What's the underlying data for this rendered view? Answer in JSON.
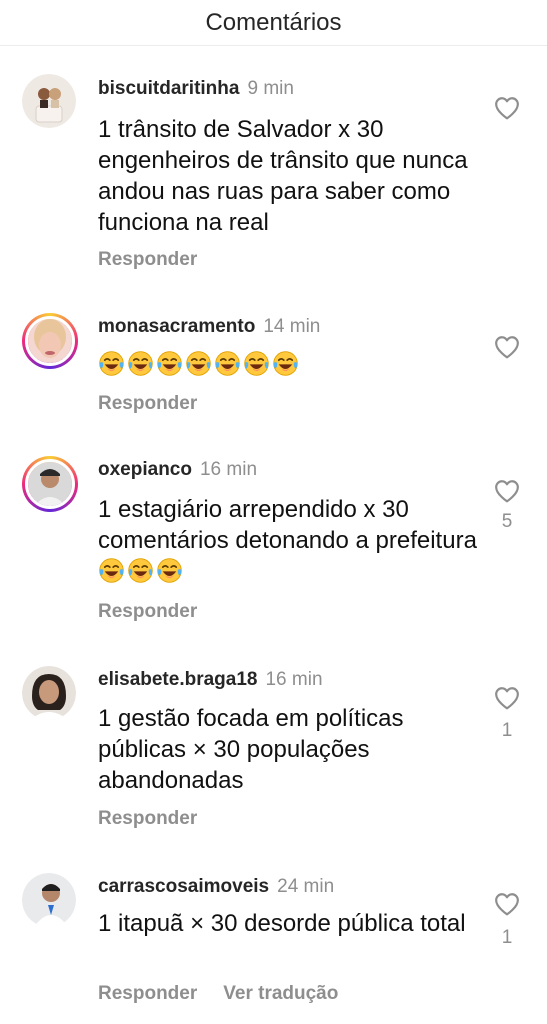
{
  "header": {
    "title": "Comentários"
  },
  "comments": [
    {
      "username": "biscuitdaritinha",
      "time": "9 min",
      "text": "1 trânsito de Salvador x 30 engenheiros de trânsito que nunca andou nas ruas para saber como funciona na real",
      "reply_label": "Responder",
      "like_count": ""
    },
    {
      "username": "monasacramento",
      "time": "14 min",
      "text": "",
      "emoji_count": 7,
      "reply_label": "Responder",
      "like_count": ""
    },
    {
      "username": "oxepianco",
      "time": "16 min",
      "text": "1 estagiário arrependido x 30 comentários detonando a prefeitura",
      "emoji_count": 3,
      "reply_label": "Responder",
      "like_count": "5"
    },
    {
      "username": "elisabete.braga18",
      "time": "16 min",
      "text": "1 gestão focada em políticas públicas × 30 populações abandonadas",
      "reply_label": "Responder",
      "like_count": "1"
    },
    {
      "username": "carrascosaimoveis",
      "time": "24 min",
      "text": "1 itapuã × 30 desorde pública total",
      "reply_label": "Responder",
      "translate_label": "Ver tradução",
      "like_count": "1"
    }
  ],
  "icons": {
    "like": "heart-outline-icon",
    "emoji": "face-with-tears-of-joy-icon"
  },
  "colors": {
    "secondary_text": "#8e8e8e",
    "story_ring": "#ee2a7b"
  }
}
